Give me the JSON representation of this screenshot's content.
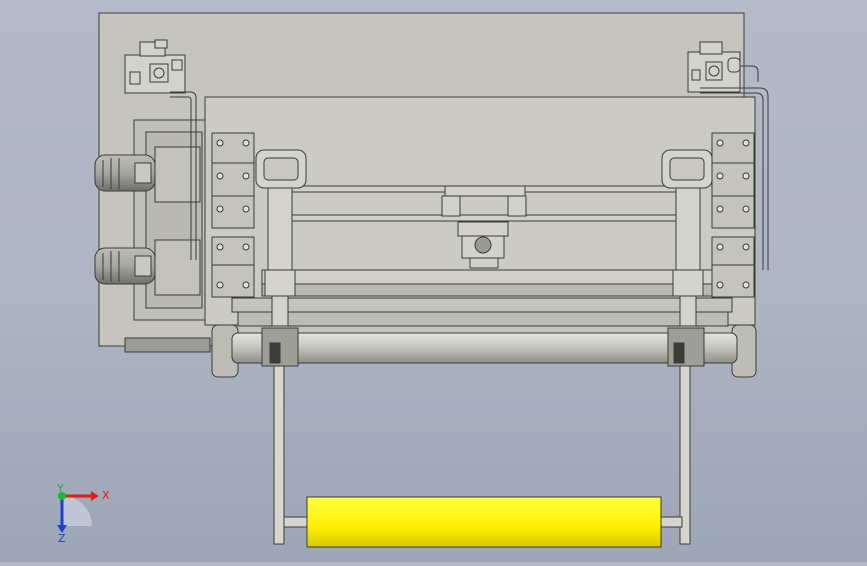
{
  "view": {
    "type": "cad-3d-viewport",
    "background_top": "#b4bac7",
    "background_bottom": "#9da6b6"
  },
  "colors": {
    "part_fill": "#c9c9c2",
    "part_fill_dark": "#b3b3ab",
    "edge": "#3a3a3a",
    "roller_highlight": "#fff200"
  },
  "triad": {
    "x_label": "X",
    "y_label": "Y",
    "z_label": "Z",
    "x_color": "#e01c1c",
    "y_color": "#18b830",
    "z_color": "#2040d0"
  }
}
